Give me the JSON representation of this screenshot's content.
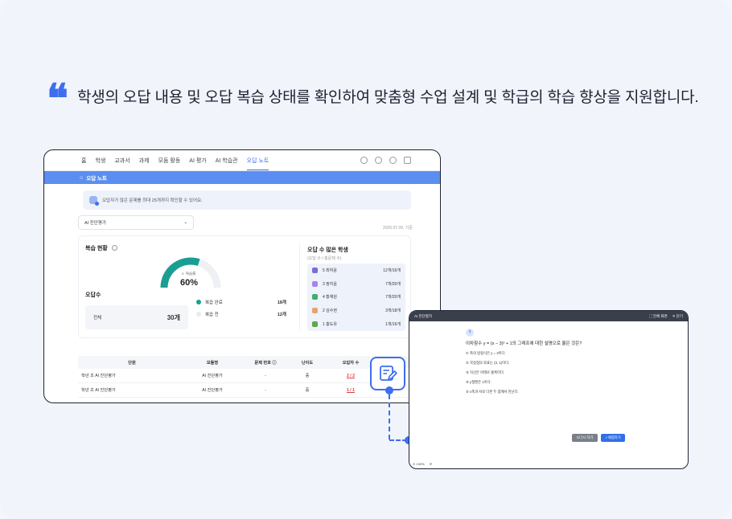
{
  "headline": {
    "quote_glyph": "❝",
    "text": "학생의 오답 내용 및 오답 복습 상태를 확인하여 맞춤형 수업 설계 및 학급의 학습 향상을 지원합니다."
  },
  "nav": {
    "items": [
      "홈",
      "학생",
      "교과서",
      "과제",
      "모둠 활동",
      "AI 평가",
      "AI 학습관",
      "오답 노트"
    ],
    "active_index": 7
  },
  "breadcrumb": {
    "label": "오답 노트"
  },
  "notice": {
    "text": "오답자가 많은 문제를 최대 25개까지 확인할 수 있어요."
  },
  "filter": {
    "selected": "AI 진단평가"
  },
  "date_stamp": "2025.07.09. 기준",
  "review_status": {
    "title": "복습 현황",
    "gauge_label": "복습률",
    "gauge_value": "60%",
    "gauge_fraction": 0.6,
    "wrong_count_title": "오답수",
    "total_label": "전체",
    "total_value": "30개",
    "done_label": "복습 완료",
    "done_value": "18개",
    "before_label": "복습 전",
    "before_value": "12개"
  },
  "top_students": {
    "title": "오답 수 많은 학생",
    "subtitle": "(오답 수 / 총문제 수)",
    "rows": [
      {
        "name": "5 최하윤",
        "value": "12개/16개"
      },
      {
        "name": "3 정지윤",
        "value": "7개/20개"
      },
      {
        "name": "4 황재원",
        "value": "7개/20개"
      },
      {
        "name": "2 김수현",
        "value": "3개/18개"
      },
      {
        "name": "1 홍도유",
        "value": "1개/16개"
      }
    ]
  },
  "table": {
    "headers": [
      "단원",
      "모듈명",
      "문제 번호",
      "난이도",
      "오답자 수"
    ],
    "rows": [
      {
        "unit": "학년 초 AI 진단평가",
        "module": "AI 진단평가",
        "num": "-",
        "level": "중",
        "wrong": "2 / 2"
      },
      {
        "unit": "학년 초 AI 진단평가",
        "module": "AI 진단평가",
        "num": "-",
        "level": "중",
        "wrong": "1 / 1"
      }
    ]
  },
  "viewer": {
    "title": "AI 진단평가",
    "actions": [
      "전체 화면",
      "닫기"
    ],
    "badge": "?",
    "question": "이차함수 y = (x − 3)² + 1의 그래프에 대한 설명으로 옳은 것은?",
    "choices": [
      "① 축의 방정식은 y = 3이다.",
      "② 꼭짓점의 좌표는 (3, 1)이다.",
      "③ 직선은 아래로 볼록이다.",
      "④ y절편은 1이다.",
      "⑤ x축과 서로 다른 두 점에서 만난다."
    ],
    "retry_label": "다시 하기",
    "grade_label": "채점하기",
    "zoom": "100%"
  },
  "colors": {
    "accent": "#3d6ef0",
    "gauge": "#1a9e92",
    "wrong": "#e03b3b"
  }
}
